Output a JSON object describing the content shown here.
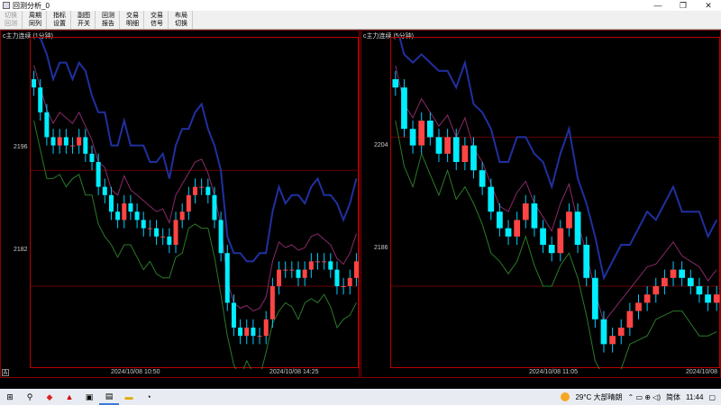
{
  "window": {
    "title": "回测分析_0",
    "controls": [
      "—",
      "❐",
      "✕"
    ]
  },
  "toolbar": {
    "buttons": [
      {
        "line1": "切换",
        "line2": "回测",
        "disabled": true
      },
      {
        "line1": "周期",
        "line2": "同列"
      },
      {
        "line1": "指标",
        "line2": "设置"
      },
      {
        "line1": "副图",
        "line2": "开关"
      },
      {
        "line1": "回测",
        "line2": "报告"
      },
      {
        "line1": "交易",
        "line2": "明细"
      },
      {
        "line1": "交易",
        "line2": "信号"
      },
      {
        "line1": "布局",
        "line2": "切换"
      }
    ]
  },
  "left_chart": {
    "title": "c主力连续 (1分钟)",
    "y_labels": [
      "2196",
      "2182"
    ],
    "x_labels": [
      "2024/10/08 10:50",
      "2024/10/08 14:25"
    ],
    "corner": "A"
  },
  "right_chart": {
    "title": "c主力连续 (5分钟)",
    "y_labels": [
      "2204",
      "2186"
    ],
    "x_labels": [
      "2024/10/08 11:05",
      "2024/10/08"
    ]
  },
  "chart_data": [
    {
      "type": "candlestick",
      "title": "c主力连续 (1分钟)",
      "ylim": [
        2172,
        2212
      ],
      "y_ticks": [
        2196,
        2182
      ],
      "x_ticks": [
        "2024/10/08 10:50",
        "2024/10/08 14:25"
      ],
      "close": [
        2206,
        2203,
        2200,
        2199,
        2200,
        2199,
        2199,
        2200,
        2198,
        2197,
        2194,
        2193,
        2191,
        2190,
        2192,
        2191,
        2190,
        2189,
        2189,
        2188,
        2188,
        2187,
        2190,
        2191,
        2193,
        2194,
        2194,
        2193,
        2190,
        2186,
        2180,
        2177,
        2176,
        2177,
        2176,
        2176,
        2178,
        2182,
        2184,
        2184,
        2184,
        2183,
        2184,
        2185,
        2185,
        2185,
        2184,
        2182,
        2182,
        2183,
        2185
      ]
    },
    {
      "type": "candlestick",
      "title": "c主力连续 (5分钟)",
      "ylim": [
        2176,
        2216
      ],
      "y_ticks": [
        2204,
        2186
      ],
      "x_ticks": [
        "2024/10/08 11:05",
        "2024/10/08"
      ],
      "close": [
        2210,
        2205,
        2203,
        2206,
        2204,
        2202,
        2204,
        2201,
        2203,
        2200,
        2198,
        2195,
        2193,
        2192,
        2194,
        2196,
        2193,
        2191,
        2190,
        2193,
        2195,
        2191,
        2187,
        2182,
        2179,
        2180,
        2181,
        2183,
        2184,
        2185,
        2186,
        2187,
        2188,
        2187,
        2186,
        2185,
        2184,
        2185
      ]
    }
  ],
  "taskbar": {
    "weather": "29°C  大部晴朗",
    "lang": "简体",
    "time": "11:44"
  }
}
